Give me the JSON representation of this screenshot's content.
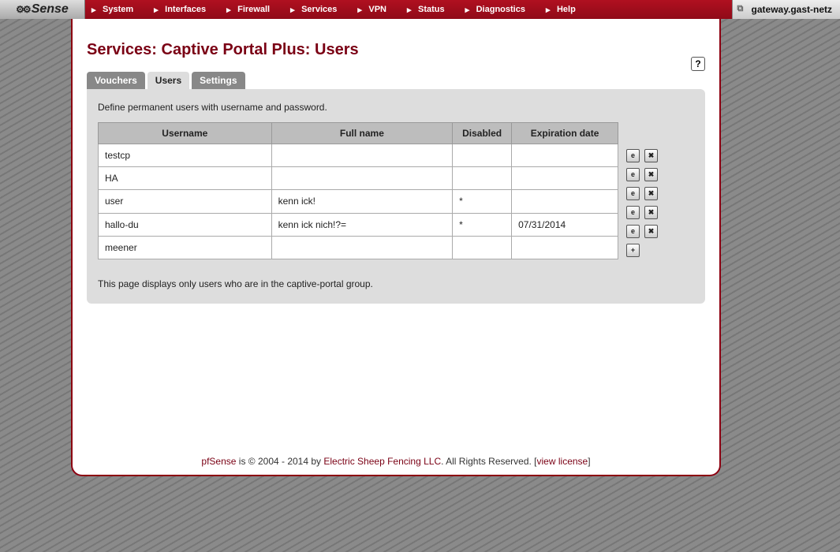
{
  "logo": "Sense",
  "nav": [
    "System",
    "Interfaces",
    "Firewall",
    "Services",
    "VPN",
    "Status",
    "Diagnostics",
    "Help"
  ],
  "hostname": "gateway.gast-netz",
  "page_title": "Services: Captive Portal Plus: Users",
  "tabs": {
    "vouchers": "Vouchers",
    "users": "Users",
    "settings": "Settings"
  },
  "intro": "Define permanent users with username and password.",
  "columns": {
    "username": "Username",
    "fullname": "Full name",
    "disabled": "Disabled",
    "expiration": "Expiration date"
  },
  "rows": [
    {
      "username": "testcp",
      "fullname": "",
      "disabled": "",
      "expiration": ""
    },
    {
      "username": "HA",
      "fullname": "",
      "disabled": "",
      "expiration": ""
    },
    {
      "username": "user",
      "fullname": "kenn ick!",
      "disabled": "*",
      "expiration": ""
    },
    {
      "username": "hallo-du",
      "fullname": "kenn ick nich!?=",
      "disabled": "*",
      "expiration": "07/31/2014"
    },
    {
      "username": "meener",
      "fullname": "",
      "disabled": "",
      "expiration": ""
    }
  ],
  "note": "This page displays only users who are in the captive-portal group.",
  "footer": {
    "brand": "pfSense",
    "mid": " is © 2004 - 2014 by ",
    "company": "Electric Sheep Fencing LLC",
    "rights": ". All Rights Reserved. [",
    "license": "view license",
    "end": "]"
  }
}
